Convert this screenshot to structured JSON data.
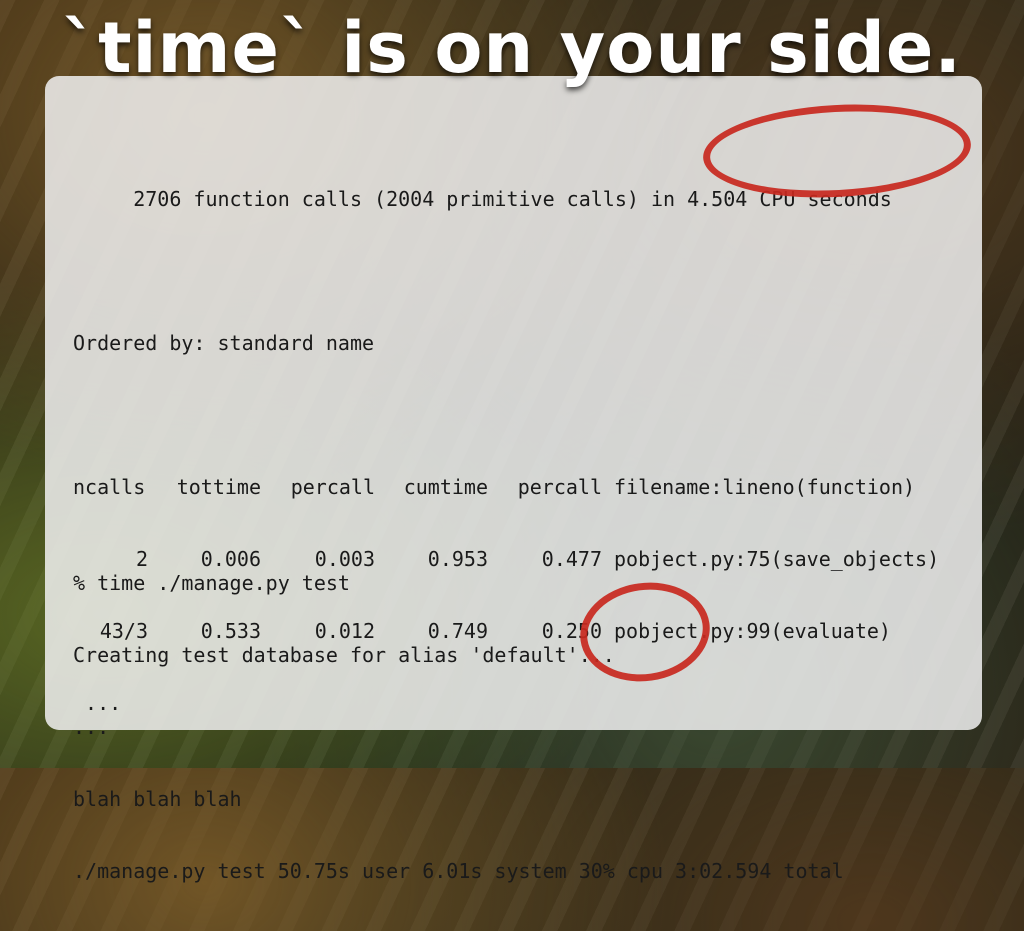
{
  "title": "`time` is on your side.",
  "profile": {
    "summary": "     2706 function calls (2004 primitive calls) in 4.504 CPU seconds",
    "ordered_by": "Ordered by: standard name",
    "columns": [
      "ncalls",
      "tottime",
      "percall",
      "cumtime",
      "percall",
      "filename:lineno(function)"
    ],
    "rows": [
      {
        "ncalls": "2",
        "tottime": "0.006",
        "percall": "0.003",
        "cumtime": "0.953",
        "percall2": "0.477",
        "file": "pobject.py:75(save_objects)"
      },
      {
        "ncalls": "43/3",
        "tottime": "0.533",
        "percall": "0.012",
        "cumtime": "0.749",
        "percall2": "0.250",
        "file": "pobject.py:99(evaluate)"
      }
    ],
    "ellipsis": " ..."
  },
  "time_cmd": {
    "command": "% time ./manage.py test",
    "line2": "Creating test database for alias 'default'...",
    "line3": "...",
    "line4": "blah blah blah",
    "line5": "./manage.py test 50.75s user 6.01s system 30% cpu 3:02.594 total"
  },
  "annotations": {
    "circle_color": "#c8281e"
  }
}
